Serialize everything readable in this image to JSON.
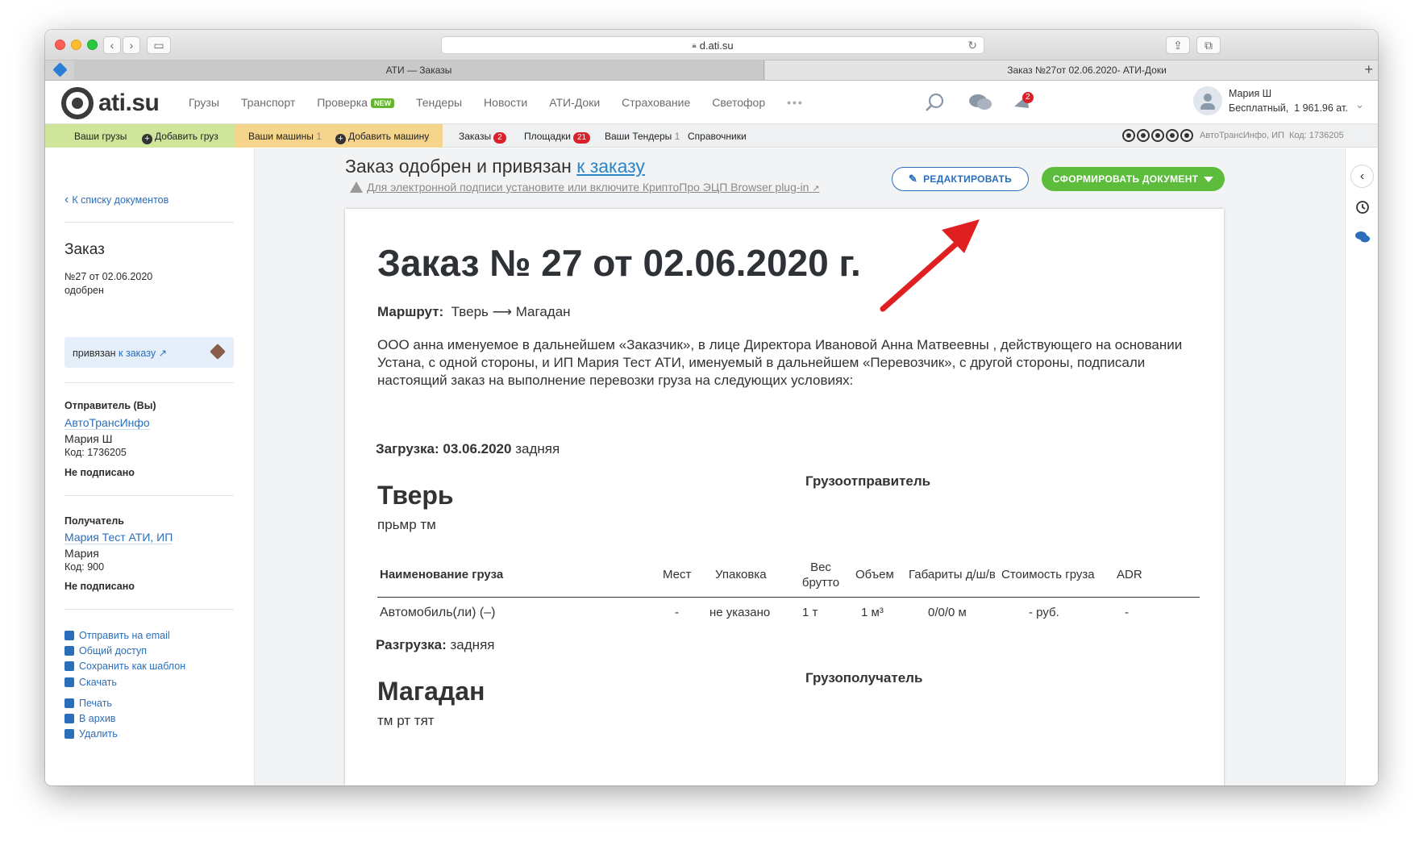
{
  "browser": {
    "url": "d.ati.su",
    "tabs": [
      {
        "label": "АТИ — Заказы"
      },
      {
        "label": "Заказ №27от 02.06.2020- АТИ-Доки"
      }
    ]
  },
  "header": {
    "logo": "ati.su",
    "nav": [
      "Грузы",
      "Транспорт",
      "Проверка",
      "Тендеры",
      "Новости",
      "АТИ-Доки",
      "Страхование",
      "Светофор"
    ],
    "new_badge": "NEW",
    "more": "•••",
    "notify_count": "2",
    "user_name": "Мария Ш",
    "user_plan": "Бесплатный,",
    "user_balance": "1 961.96 ат."
  },
  "subnav": {
    "my_cargo": "Ваши грузы",
    "add_cargo": "Добавить груз",
    "my_cars": "Ваши машины",
    "my_cars_count": "1",
    "add_car": "Добавить машину",
    "orders": "Заказы",
    "orders_count": "2",
    "platforms": "Площадки",
    "platforms_count": "21",
    "tenders": "Ваши Тендеры",
    "tenders_count": "1",
    "refs": "Справочники",
    "company": "АвтоТрансИнфо, ИП",
    "code": "Код: 1736205"
  },
  "sidebar": {
    "back": "К списку документов",
    "title": "Заказ",
    "number": "№27 от 02.06.2020",
    "status": "одобрен",
    "bound_text": "привязан",
    "bound_link": "к заказу",
    "sender_label": "Отправитель (Вы)",
    "sender_company": "АвтоТрансИнфо",
    "sender_name": "Мария Ш",
    "sender_code": "Код: 1736205",
    "sender_sign": "Не подписано",
    "receiver_label": "Получатель",
    "receiver_company": "Мария Тест АТИ, ИП",
    "receiver_name": "Мария",
    "receiver_code": "Код: 900",
    "receiver_sign": "Не подписано",
    "actions": [
      "Отправить на email",
      "Общий доступ",
      "Сохранить как шаблон",
      "Скачать",
      "Печать",
      "В архив",
      "Удалить"
    ]
  },
  "main": {
    "title": "Заказ одобрен и привязан",
    "title_link": "к заказу",
    "warning": "Для электронной подписи установите или включите КриптоПро ЭЦП Browser plug-in",
    "edit_button": "РЕДАКТИРОВАТЬ",
    "generate_button": "СФОРМИРОВАТЬ ДОКУМЕНТ"
  },
  "document": {
    "heading": "Заказ №  27 от 02.06.2020 г.",
    "route_label": "Маршрут:",
    "route_value": "Тверь ⟶ Магадан",
    "paragraph": "ООО анна именуемое в дальнейшем «Заказчик», в лице Директора Ивановой Анна Матвеевны , действующего на основании Устана, с одной стороны, и ИП Мария Тест АТИ, именуемый в дальнейшем «Перевозчик», с другой стороны, подписали настоящий заказ на выполнение перевозки груза на следующих условиях:",
    "loading_label": "Загрузка: 03.06.2020",
    "loading_type": "задняя",
    "shipper_label": "Грузоотправитель",
    "load_city": "Тверь",
    "load_addr": "прьмр тм",
    "table": {
      "headers": [
        "Наименование груза",
        "Мест",
        "Упаковка",
        "Вес брутто",
        "Объем",
        "Габариты д/ш/в",
        "Стоимость груза",
        "ADR"
      ],
      "row": [
        "Автомобиль(ли) (–)",
        "-",
        "не указано",
        "1 т",
        "1 м³",
        "0/0/0 м",
        "- руб.",
        "-"
      ]
    },
    "unloading_label": "Разгрузка:",
    "unloading_type": "задняя",
    "consignee_label": "Грузополучатель",
    "unload_city": "Магадан",
    "unload_addr": "тм рт тят"
  },
  "colors": {
    "accent_blue": "#2a6ebb",
    "green_button": "#5dbc3b",
    "arrow_red": "#e02020"
  }
}
